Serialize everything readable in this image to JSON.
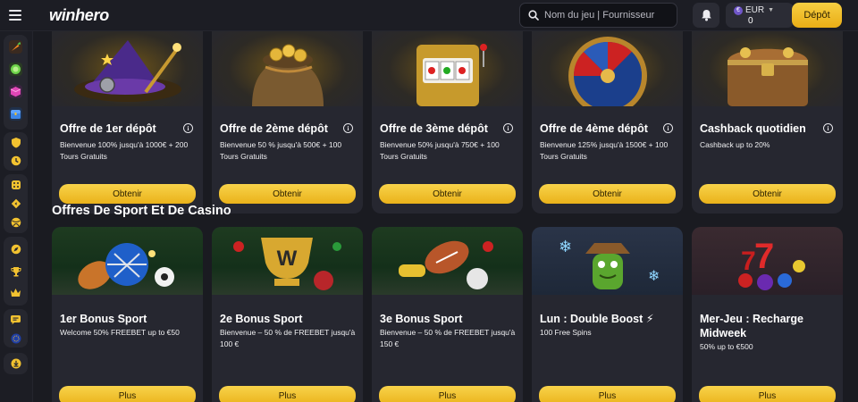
{
  "header": {
    "logo": "winhero",
    "search_placeholder": "Nom du jeu | Fournisseur",
    "currency": "EUR",
    "balance": "0",
    "deposit_label": "Dépôt"
  },
  "sidebar": {
    "icons": [
      "carrot-icon",
      "lime-icon",
      "cube-icon",
      "chest-icon",
      "shield-icon",
      "clock-icon",
      "dice-icon",
      "diamond-icon",
      "ball-icon",
      "compass-icon",
      "trophy-icon",
      "crown-icon",
      "chat-icon",
      "globe-icon",
      "download-icon"
    ]
  },
  "promos": [
    {
      "title": "Offre de 1er dépôt",
      "desc": "Bienvenue 100% jusqu'à 1000€ + 200 Tours Gratuits",
      "button": "Obtenir"
    },
    {
      "title": "Offre de 2ème dépôt",
      "desc": "Bienvenue 50 % jusqu'à 500€ + 100 Tours Gratuits",
      "button": "Obtenir"
    },
    {
      "title": "Offre de 3ème dépôt",
      "desc": "Bienvenue 50% jusqu'à 750€ + 100 Tours Gratuits",
      "button": "Obtenir"
    },
    {
      "title": "Offre de 4ème dépôt",
      "desc": "Bienvenue 125% jusqu'à 1500€ + 100 Tours Gratuits",
      "button": "Obtenir"
    },
    {
      "title": "Cashback quotidien",
      "desc": "Cashback up to 20%",
      "button": "Obtenir"
    }
  ],
  "sport_section": {
    "title": "Offres De Sport Et De Casino",
    "cards": [
      {
        "title": "1er Bonus Sport",
        "desc": "Welcome 50% FREEBET up to €50",
        "button": "Plus"
      },
      {
        "title": "2e Bonus Sport",
        "desc": "Bienvenue – 50 % de FREEBET jusqu'à 100 €",
        "button": "Plus"
      },
      {
        "title": "3e Bonus Sport",
        "desc": "Bienvenue – 50 % de FREEBET jusqu'à 150 €",
        "button": "Plus"
      },
      {
        "title": "Lun : Double Boost ⚡",
        "desc": "100 Free Spins",
        "button": "Plus"
      },
      {
        "title": "Mer-Jeu : Recharge Midweek",
        "desc": "50% up to €500",
        "button": "Plus"
      }
    ]
  },
  "colors": {
    "accent": "#f2c230",
    "background": "#1a1b21",
    "card": "#262730"
  }
}
